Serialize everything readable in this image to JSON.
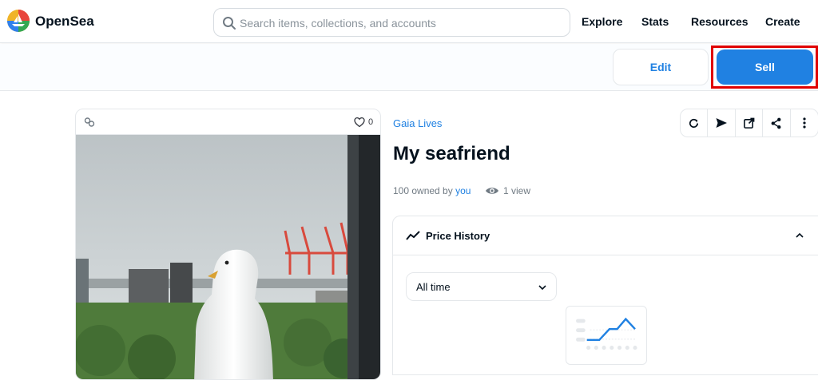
{
  "header": {
    "brand": "OpenSea",
    "search_placeholder": "Search items, collections, and accounts",
    "nav": [
      "Explore",
      "Stats",
      "Resources",
      "Create"
    ]
  },
  "actions": {
    "edit_label": "Edit",
    "sell_label": "Sell"
  },
  "card": {
    "favorites_count": "0"
  },
  "asset": {
    "collection": "Gaia Lives",
    "title": "My seafriend",
    "owned_prefix": "100 owned by ",
    "owner": "you",
    "views": "1 view"
  },
  "tools": [
    "refresh-icon",
    "send-icon",
    "external-link-icon",
    "share-icon",
    "more-icon"
  ],
  "price_history": {
    "title": "Price History",
    "filter_value": "All time"
  },
  "colors": {
    "accent": "#2081e2",
    "highlight": "#e00000",
    "text": "#04111d",
    "muted": "#707a83"
  }
}
